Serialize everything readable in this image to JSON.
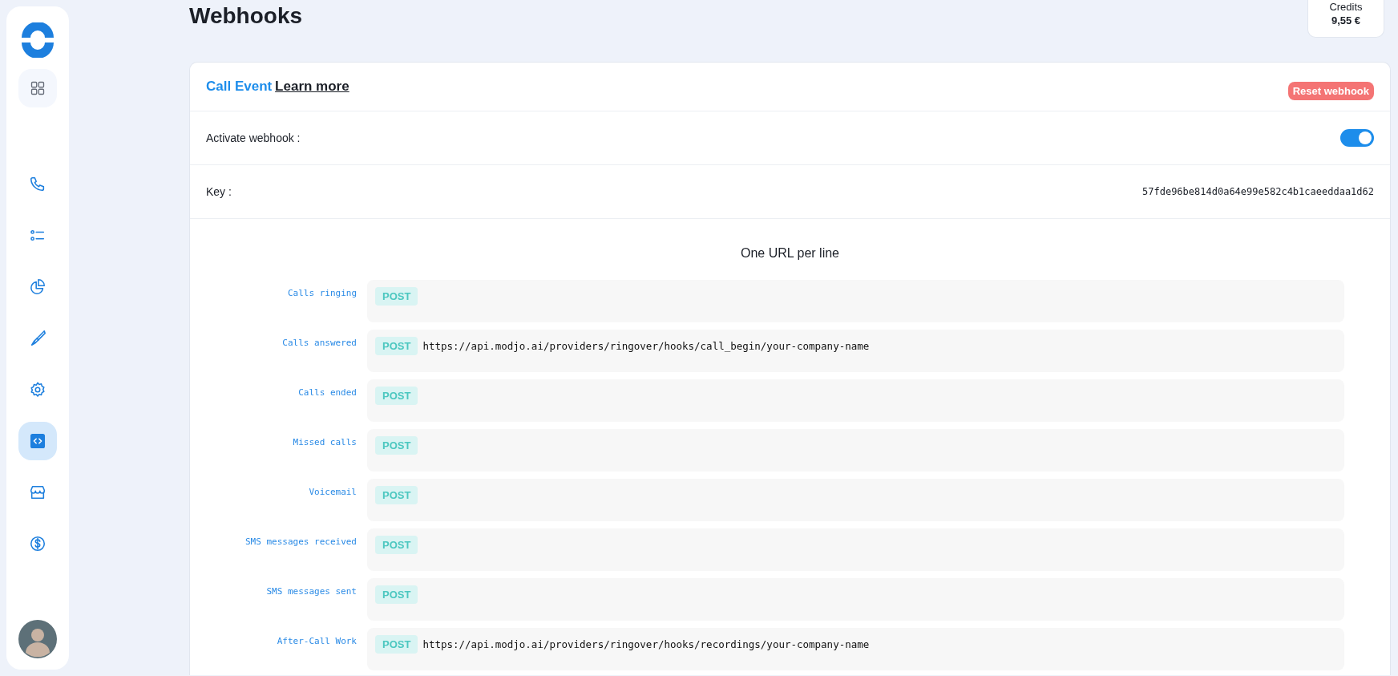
{
  "sidebar": {
    "items": [
      {
        "kind": "phone",
        "selected": false
      },
      {
        "kind": "list",
        "selected": false
      },
      {
        "kind": "pie",
        "selected": false
      },
      {
        "kind": "brush",
        "selected": false
      },
      {
        "kind": "gear",
        "selected": false
      },
      {
        "kind": "code",
        "selected": true
      },
      {
        "kind": "store",
        "selected": false
      },
      {
        "kind": "dollar",
        "selected": false
      }
    ]
  },
  "header": {
    "title": "Webhooks",
    "credits": {
      "label": "Credits",
      "value": "9,55 €"
    }
  },
  "panel": {
    "title": "Call Event",
    "link": "Learn more",
    "reset_button": "Reset webhook",
    "activate": {
      "label": "Activate webhook :",
      "on": true
    },
    "key": {
      "label": "Key :",
      "value": "57fde96be814d0a64e99e582c4b1caeeddaa1d62"
    },
    "hint": "One URL per line",
    "events": [
      {
        "label": "Calls ringing",
        "method": "POST"
      },
      {
        "label": "Calls answered",
        "method": "POST",
        "value": "https://api.modjo.ai/providers/ringover/hooks/call_begin/your-company-name"
      },
      {
        "label": "Calls ended",
        "method": "POST"
      },
      {
        "label": "Missed calls",
        "method": "POST"
      },
      {
        "label": "Voicemail",
        "method": "POST"
      },
      {
        "label": "SMS messages received",
        "method": "POST"
      },
      {
        "label": "SMS messages sent",
        "method": "POST"
      },
      {
        "label": "After-Call Work",
        "method": "POST",
        "value": "https://api.modjo.ai/providers/ringover/hooks/recordings/your-company-name"
      }
    ]
  }
}
